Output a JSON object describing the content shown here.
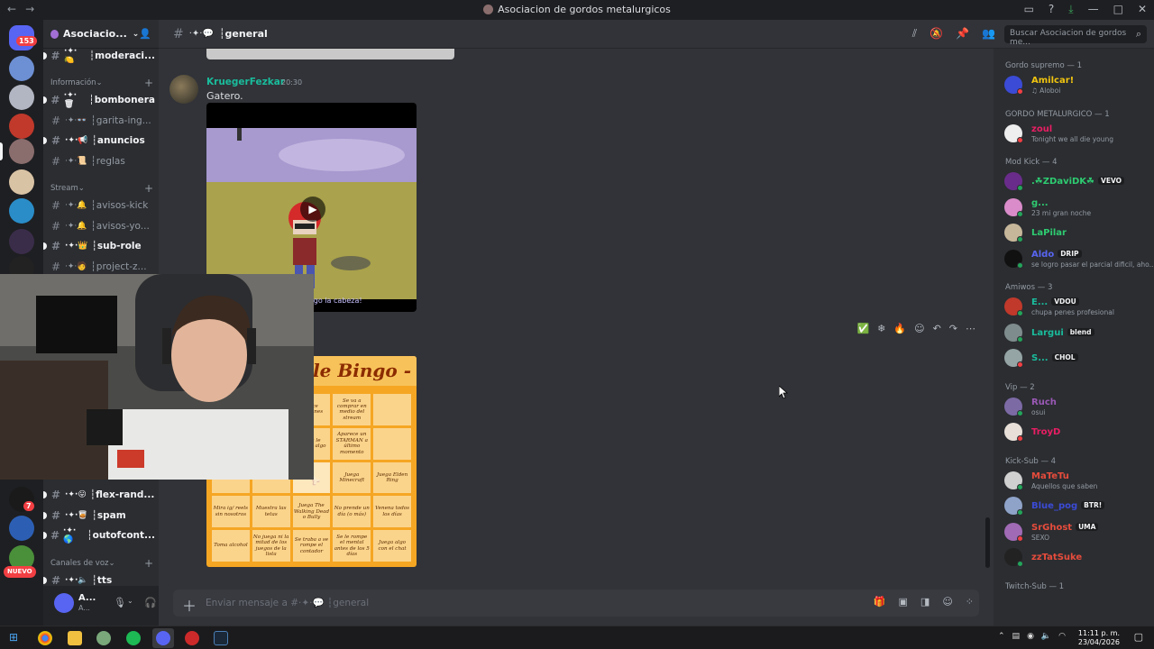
{
  "window": {
    "title": "Asociacion de gordos metalurgicos"
  },
  "guild_rail": {
    "badge_count": "153",
    "badge_7": "7",
    "new_label": "NUEVO"
  },
  "server": {
    "name": "Asociacio...",
    "channels_top": [
      {
        "prefix": "·✦·🍋",
        "name": "┆moderaci...",
        "unread": true
      }
    ],
    "cat_info": "Información",
    "channels_info": [
      {
        "prefix": "·✦·🗑",
        "name": "┆bombonera",
        "unread": true
      },
      {
        "prefix": "·✦·👓",
        "name": "┆garita-ing...",
        "unread": false
      },
      {
        "prefix": "·✦·📢",
        "name": "┆anuncios",
        "unread": true
      },
      {
        "prefix": "·✦·📜",
        "name": "┆reglas",
        "unread": false
      }
    ],
    "cat_stream": "Stream",
    "channels_stream": [
      {
        "prefix": "·✦·🔔",
        "name": "┆avisos-kick",
        "unread": false
      },
      {
        "prefix": "·✦·🔔",
        "name": "┆avisos-yo...",
        "unread": false
      },
      {
        "prefix": "·✦·👑",
        "name": "┆sub-role",
        "unread": true
      },
      {
        "prefix": "·✦·🧑",
        "name": "┆project-z...",
        "unread": false
      }
    ],
    "channels_bottom": [
      {
        "prefix": "·✦·😛",
        "name": "┆flex-rand...",
        "unread": true
      },
      {
        "prefix": "·✦·🥃",
        "name": "┆spam",
        "unread": true
      },
      {
        "prefix": "·✦·🌎",
        "name": "┆outofcont...",
        "unread": true
      }
    ],
    "cat_voice": "Canales de voz",
    "voice_channels": [
      {
        "prefix": "·✦·🔈",
        "name": "┆tts",
        "unread": true
      }
    ]
  },
  "user_panel": {
    "name": "A...",
    "status": "A..."
  },
  "channel_header": {
    "prefix": "·✦·💬",
    "name": "┆general",
    "search_placeholder": "Buscar Asociacion de gordos me..."
  },
  "messages": {
    "author": "KruegerFezkar",
    "time": "20:30",
    "text": "Gatero.",
    "video_caption": "¡Y después, no me duele tengo la cabeza!",
    "hover_reactions": [
      "✅",
      "❄",
      "🔥"
    ],
    "bingo_title": "le Bingo -",
    "bingo_cells": [
      "",
      "los",
      "Hace flexiones",
      "Se va a comprar en medio del stream",
      "",
      "",
      "en el",
      "Sara le rompe algo",
      "Aparece un STARMAN a último momento",
      "",
      "en el CS",
      "piso",
      "",
      "Juega Minecraft",
      "Juega Elden Ring",
      "Mira ig/ reels sin nosotros",
      "Muestra las tetas",
      "Juega The Walking Dead o Bully",
      "No prende un día (o más)",
      "Venena todos los días",
      "Toma alcohol",
      "No juega ni la mitad de los juegos de la lista",
      "Se traba a se rompe el contador",
      "Se le rompe el mental antes de los 5 días",
      "Juega algo con el chat"
    ]
  },
  "composer": {
    "placeholder": "Enviar mensaje a #·✦·💬 ┆general"
  },
  "members": {
    "groups": [
      {
        "title": "Gordo supremo — 1",
        "items": [
          {
            "name": "Amilcar!",
            "sub": "♫ Aloboi",
            "color": "#f1c40f",
            "tag": "",
            "av": "#3b4bd6",
            "status": "#f23f43"
          }
        ]
      },
      {
        "title": "GORDO METALURGICO — 1",
        "items": [
          {
            "name": "zoul",
            "sub": "Tonight we all die young",
            "color": "#e91e63",
            "tag": "",
            "av": "#eeeeee",
            "status": "#f23f43"
          }
        ]
      },
      {
        "title": "Mod Kick — 4",
        "items": [
          {
            "name": ".☘ZDaviDK☘",
            "sub": "",
            "color": "#2ecc71",
            "tag": "VEVO",
            "av": "#6a2c8a",
            "status": "#23a55a"
          },
          {
            "name": "g...",
            "sub": "23 mi gran noche",
            "color": "#2ecc71",
            "tag": "",
            "av": "#d98cc9",
            "status": "#23a55a"
          },
          {
            "name": "LaPilar",
            "sub": "",
            "color": "#2ecc71",
            "tag": "",
            "av": "#c7b79a",
            "status": "#23a55a"
          },
          {
            "name": "Aldo",
            "sub": "se logro pasar el parcial dificil, aho...",
            "color": "#5865f2",
            "tag": "DRIP",
            "av": "#111111",
            "status": "#23a55a"
          }
        ]
      },
      {
        "title": "Amiwos — 3",
        "items": [
          {
            "name": "E...",
            "sub": "chupa penes profesional",
            "color": "#1abc9c",
            "tag": "VDOU",
            "av": "#c0392b",
            "status": "#23a55a"
          },
          {
            "name": "Largui",
            "sub": "",
            "color": "#1abc9c",
            "tag": "blend",
            "av": "#7f8c8d",
            "status": "#23a55a"
          },
          {
            "name": "S...",
            "sub": "",
            "color": "#1abc9c",
            "tag": "CHOL",
            "av": "#95a5a6",
            "status": "#f23f43"
          }
        ]
      },
      {
        "title": "Vip — 2",
        "items": [
          {
            "name": "Ruch",
            "sub": "osui",
            "color": "#9b59b6",
            "tag": "",
            "av": "#7c6aa5",
            "status": "#23a55a"
          },
          {
            "name": "TroyD",
            "sub": "",
            "color": "#e91e63",
            "tag": "",
            "av": "#e8e0d8",
            "status": "#f23f43"
          }
        ]
      },
      {
        "title": "Kick-Sub — 4",
        "items": [
          {
            "name": "MaTeTu",
            "sub": "Aquellos que saben",
            "color": "#e74c3c",
            "tag": "",
            "av": "#d0d0d0",
            "status": "#23a55a"
          },
          {
            "name": "Blue_pog",
            "sub": "",
            "color": "#3b4bd6",
            "tag": "BTR!",
            "av": "#8fa3c9",
            "status": "#23a55a"
          },
          {
            "name": "SrGhost",
            "sub": "SEXO",
            "color": "#e74c3c",
            "tag": "UMA",
            "av": "#a06ab4",
            "status": "#f23f43"
          },
          {
            "name": "zzTatSuke",
            "sub": "",
            "color": "#e74c3c",
            "tag": "",
            "av": "#222222",
            "status": "#23a55a"
          }
        ]
      },
      {
        "title": "Twitch-Sub — 1",
        "items": []
      }
    ]
  },
  "taskbar": {
    "time": "11:11 p. m.",
    "date": "23/04/2026"
  },
  "colors": {
    "accent": "#5865f2",
    "author": "#1abc9c",
    "bingo_bg": "#f5a623"
  }
}
